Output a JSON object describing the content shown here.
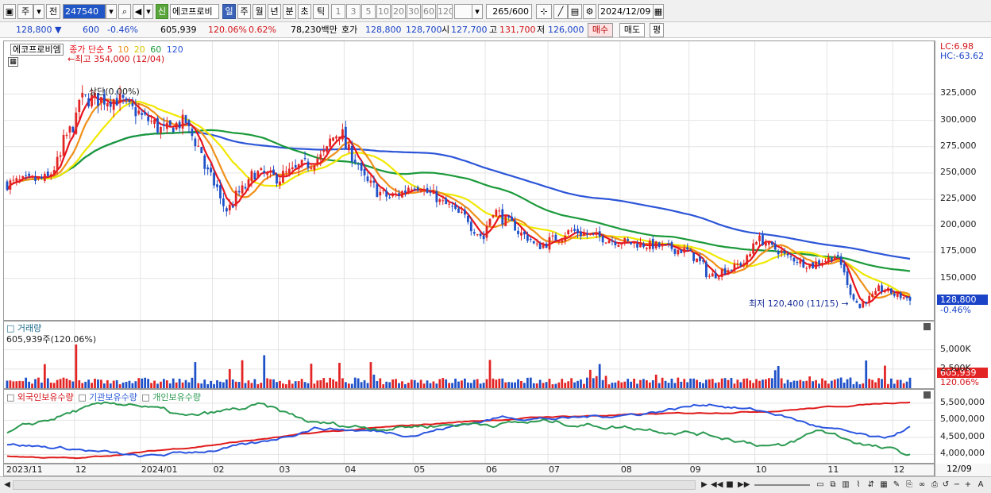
{
  "toolbar": {
    "period_label": "주",
    "prefix_label": "전",
    "code": "247540",
    "badge": "신",
    "stock_name": "에코프로비",
    "tabs": [
      "일",
      "주",
      "월",
      "년",
      "분",
      "초",
      "틱"
    ],
    "active_tab": 0,
    "intervals": [
      "1",
      "3",
      "5",
      "10",
      "20",
      "30",
      "60",
      "120"
    ],
    "count": "265",
    "count_total": "/600",
    "date": "2024/12/09"
  },
  "info": {
    "price": "128,800 ▼",
    "change": "600",
    "change_pct": "-0.46%",
    "volume": "605,939",
    "vol_ratio": "120.06%",
    "turnover": "0.62%",
    "amount": "78,230백만",
    "quote_label": "호가",
    "ask": "128,800",
    "bid": "128,700",
    "open_label": "시",
    "open": "127,700",
    "high_label": "고",
    "high": "131,700",
    "low_label": "저",
    "low": "126,000",
    "buy": "매수",
    "sell": "매도",
    "eval": "평"
  },
  "price_pane": {
    "name": "에코프로비엠",
    "legend_prefix": "종가 단순",
    "ma_periods": [
      "5",
      "10",
      "20",
      "60",
      "120"
    ],
    "high_note": "최고 354,000 (12/04)",
    "low_note": "최저 120,400 (11/15)",
    "status_note": "상단(0.00%)",
    "lc": "LC:6.98",
    "hc": "HC:-63.62",
    "current_tag": "128,800",
    "current_pct": "-0.46%"
  },
  "volume_pane": {
    "title": "거래량",
    "note": "605,939주(120.06%)",
    "tag": "605,939",
    "tag_pct": "120.06%"
  },
  "holding_pane": {
    "legend": [
      "외국인보유수량",
      "기관보유수량",
      "개인보유수량"
    ]
  },
  "colors": {
    "up": "#e32424",
    "down": "#1e50c8",
    "ma5": "#e8141c",
    "ma10": "#f09018",
    "ma20": "#f0e800",
    "ma60": "#1b9a3a",
    "ma120": "#2c55d8",
    "foreign": "#2b55e0",
    "inst": "#e01a1a",
    "indiv": "#2c9a52"
  },
  "chart_data": [
    {
      "type": "candlestick",
      "x_ticks": [
        "2023/11",
        "12",
        "2024/01",
        "02",
        "03",
        "04",
        "05",
        "06",
        "07",
        "08",
        "09",
        "10",
        "11",
        "12",
        "12/09"
      ],
      "y_ticks": [
        "325,000",
        "300,000",
        "275,000",
        "250,000",
        "225,000",
        "200,000",
        "175,000",
        "150,000"
      ],
      "ylim": [
        115000,
        360000
      ],
      "close_anchors": [
        [
          "2023/11/01",
          240000
        ],
        [
          "2023/11/20",
          245000
        ],
        [
          "2023/12/01",
          300000
        ],
        [
          "2023/12/04",
          320000
        ],
        [
          "2023/12/20",
          320000
        ],
        [
          "2024/01/10",
          290000
        ],
        [
          "2024/01/20",
          300000
        ],
        [
          "2024/02/01",
          240000
        ],
        [
          "2024/02/07",
          215000
        ],
        [
          "2024/02/20",
          250000
        ],
        [
          "2024/03/01",
          245000
        ],
        [
          "2024/03/20",
          265000
        ],
        [
          "2024/03/28",
          290000
        ],
        [
          "2024/04/10",
          240000
        ],
        [
          "2024/04/20",
          225000
        ],
        [
          "2024/05/01",
          240000
        ],
        [
          "2024/05/25",
          205000
        ],
        [
          "2024/06/01",
          185000
        ],
        [
          "2024/06/05",
          215000
        ],
        [
          "2024/06/25",
          180000
        ],
        [
          "2024/07/10",
          195000
        ],
        [
          "2024/07/31",
          185000
        ],
        [
          "2024/08/20",
          180000
        ],
        [
          "2024/09/01",
          175000
        ],
        [
          "2024/09/10",
          152000
        ],
        [
          "2024/09/25",
          165000
        ],
        [
          "2024/10/01",
          188000
        ],
        [
          "2024/10/15",
          170000
        ],
        [
          "2024/10/25",
          162000
        ],
        [
          "2024/11/05",
          172000
        ],
        [
          "2024/11/15",
          122000
        ],
        [
          "2024/11/25",
          140000
        ],
        [
          "2024/12/09",
          128800
        ]
      ]
    },
    {
      "type": "bar",
      "name": "거래량",
      "y_ticks": [
        "5,000K",
        "2,500K"
      ],
      "ylim": [
        0,
        6000000
      ]
    },
    {
      "type": "line",
      "series_names": [
        "외국인보유수량",
        "기관보유수량",
        "개인보유수량"
      ],
      "y_ticks": [
        "5,500,000",
        "5,000,000",
        "4,500,000",
        "4,000,000"
      ],
      "ylim": [
        3800000,
        5800000
      ]
    }
  ]
}
